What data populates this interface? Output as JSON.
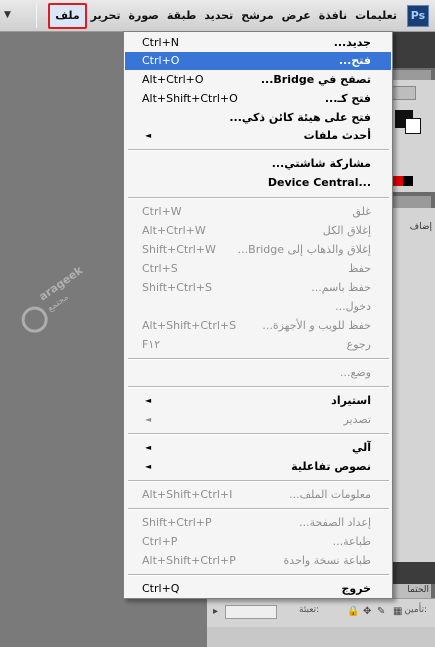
{
  "app": {
    "logo_text": "Ps"
  },
  "menubar": {
    "items": [
      "ملف",
      "تحرير",
      "صورة",
      "طبقة",
      "تحديد",
      "مرشح",
      "عرض",
      "نافذة",
      "تعليمات"
    ],
    "active_index": 0
  },
  "file_menu": {
    "items": [
      {
        "label": "جديد...",
        "shortcut": "Ctrl+N"
      },
      {
        "label": "فتح...",
        "shortcut": "Ctrl+O"
      },
      {
        "label": "تصفح في Bridge...",
        "shortcut": "Alt+Ctrl+O"
      },
      {
        "label": "فتح كـ...",
        "shortcut": "Alt+Shift+Ctrl+O"
      },
      {
        "label": "فتح على هيئة كائن ذكي...",
        "shortcut": ""
      },
      {
        "label": "أحدث ملفات",
        "shortcut": "",
        "submenu": "◄"
      },
      {
        "label": "مشاركة شاشتي...",
        "shortcut": ""
      },
      {
        "label": "Device Central...",
        "shortcut": ""
      },
      {
        "label": "غلق",
        "shortcut": "Ctrl+W"
      },
      {
        "label": "إغلاق الكل",
        "shortcut": "Alt+Ctrl+W"
      },
      {
        "label": "إغلاق والذهاب إلى Bridge...",
        "shortcut": "Shift+Ctrl+W"
      },
      {
        "label": "حفظ",
        "shortcut": "Ctrl+S"
      },
      {
        "label": "حفظ باسم...",
        "shortcut": "Shift+Ctrl+S"
      },
      {
        "label": "دخول...",
        "shortcut": ""
      },
      {
        "label": "حفظ للويب و الأجهزة...",
        "shortcut": "Alt+Shift+Ctrl+S"
      },
      {
        "label": "رجوع",
        "shortcut": "F١٢"
      },
      {
        "label": "وضع...",
        "shortcut": ""
      },
      {
        "label": "استيراد",
        "shortcut": "",
        "submenu": "◄"
      },
      {
        "label": "تصدير",
        "shortcut": "",
        "submenu": "◄"
      },
      {
        "label": "آلي",
        "shortcut": "",
        "submenu": "◄"
      },
      {
        "label": "نصوص تفاعلية",
        "shortcut": "",
        "submenu": "◄"
      },
      {
        "label": "معلومات الملف...",
        "shortcut": "Alt+Shift+Ctrl+I"
      },
      {
        "label": "إعداد الصفحة...",
        "shortcut": "Shift+Ctrl+P"
      },
      {
        "label": "طباعة...",
        "shortcut": "Ctrl+P"
      },
      {
        "label": "طباعة نسخة واحدة",
        "shortcut": "Alt+Shift+Ctrl+P"
      },
      {
        "label": "خروج",
        "shortcut": "Ctrl+Q"
      }
    ]
  },
  "panels": {
    "add_label": "إضاف",
    "layers_label": "الحتما",
    "lock_label": "تأمين:",
    "fill_label": "تعبئة:"
  },
  "watermark": {
    "line1": "arageek",
    "line2": "مجتمع"
  },
  "colors": {
    "highlight": "#3875d7",
    "active_outline": "#e01b1b"
  }
}
